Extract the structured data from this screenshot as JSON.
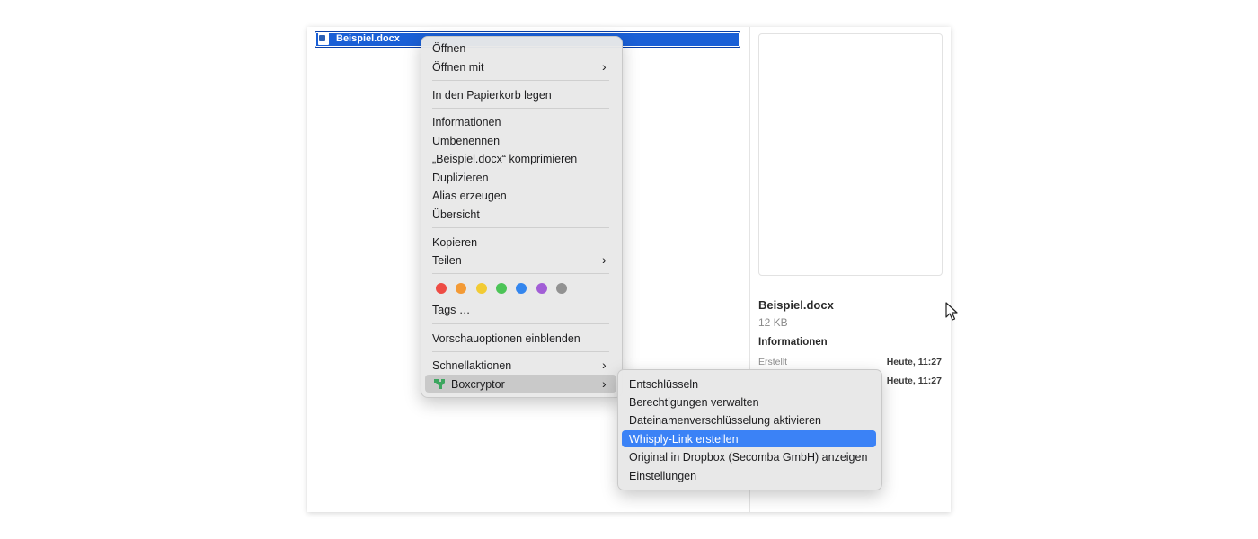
{
  "file": {
    "name": "Beispiel.docx"
  },
  "context_menu": {
    "items": [
      "Öffnen",
      "Öffnen mit",
      "In den Papierkorb legen",
      "Informationen",
      "Umbenennen",
      "„Beispiel.docx“ komprimieren",
      "Duplizieren",
      "Alias erzeugen",
      "Übersicht",
      "Kopieren",
      "Teilen",
      "Tags …",
      "Vorschauoptionen einblenden",
      "Schnellaktionen",
      "Boxcryptor"
    ],
    "tag_colors": [
      {
        "name": "red",
        "color": "#ee4c45"
      },
      {
        "name": "orange",
        "color": "#f39a35"
      },
      {
        "name": "yellow",
        "color": "#f2cb34"
      },
      {
        "name": "green",
        "color": "#4cc457"
      },
      {
        "name": "blue",
        "color": "#3486ee"
      },
      {
        "name": "purple",
        "color": "#a25ed6"
      },
      {
        "name": "gray",
        "color": "#929292"
      }
    ]
  },
  "submenu": {
    "items": [
      "Entschlüsseln",
      "Berechtigungen verwalten",
      "Dateinamenverschlüsselung aktivieren",
      "Whisply-Link erstellen",
      "Original in Dropbox (Secomba GmbH) anzeigen",
      "Einstellungen"
    ]
  },
  "preview": {
    "title": "Beispiel.docx",
    "size": "12 KB",
    "info_heading": "Informationen",
    "created_label": "Erstellt",
    "created_value": "Heute, 11:27",
    "modified_value": "Heute, 11:27"
  },
  "colors": {
    "selection": "#1a5fd6",
    "highlight": "#3b82f6",
    "boxcryptor": "#3ca65f"
  }
}
